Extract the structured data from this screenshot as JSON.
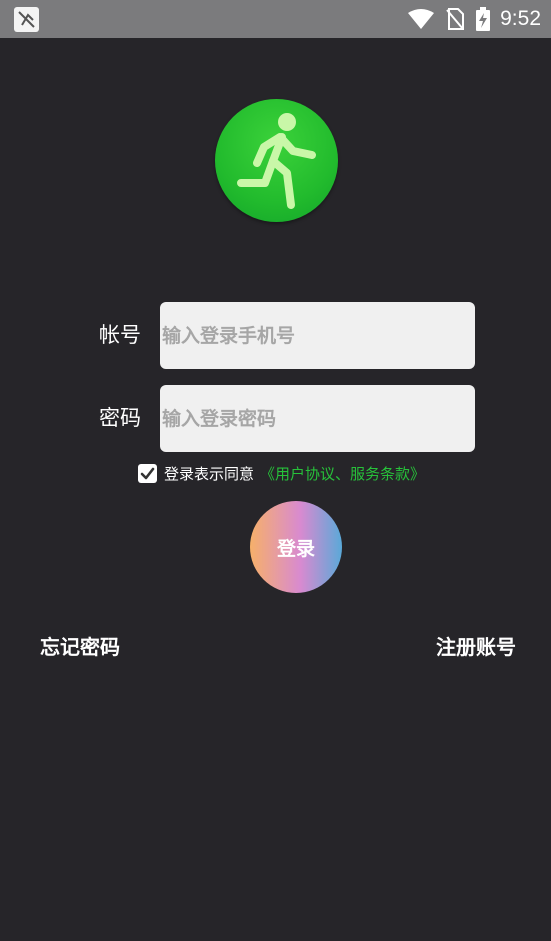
{
  "status_bar": {
    "time": "9:52",
    "icons": [
      "app-notification-icon",
      "wifi-icon",
      "no-sim-icon",
      "battery-charging-icon"
    ]
  },
  "logo": {
    "icon": "running-person-icon",
    "color": "#22bb2d"
  },
  "form": {
    "account_label": "帐号",
    "account_placeholder": "输入登录手机号",
    "account_value": "",
    "password_label": "密码",
    "password_placeholder": "输入登录密码",
    "password_value": "",
    "agree_checked": true,
    "agree_text": "登录表示同意",
    "agree_link": "《用户协议、服务条款》",
    "login_label": "登录"
  },
  "footer": {
    "forgot_password": "忘记密码",
    "register": "注册账号"
  },
  "colors": {
    "background": "#262529",
    "status_bar": "#7b7b7d",
    "accent_green": "#27c13a"
  }
}
